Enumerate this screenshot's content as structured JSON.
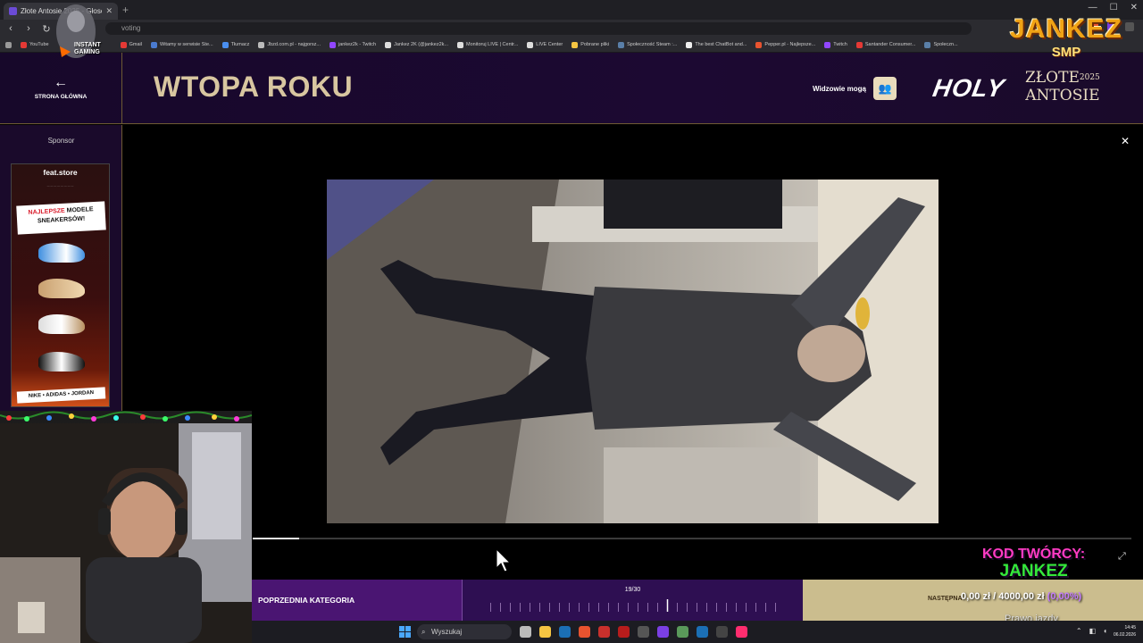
{
  "browser": {
    "tab_title": "Złote Antosie 2025 - Głosowanie",
    "url": "voting",
    "bookmarks": [
      "YouTube",
      "Gmail",
      "Witamy w serwisie Ste...",
      "Tłumacz",
      "Jbzd.com.pl - najgorsz...",
      "jankez2k - Twitch",
      "Jankez 2K (@jankez2k...",
      "Monitoruj LIVE | Centr...",
      "LIVE Center",
      "Pobrane pliki",
      "Społeczność Steam :...",
      "The best ChatBot and...",
      "Pepper.pl - Najlepsze...",
      "Twitch",
      "Santander Consumer...",
      "Społeczn..."
    ]
  },
  "header": {
    "back_label": "STRONA GŁÓWNA",
    "title": "WTOPA ROKU",
    "viewers_label": "Widzowie mogą",
    "logo_holy": "HOLY",
    "logo_zlote_line1": "ZŁOTE",
    "logo_year": "2025",
    "logo_zlote_line2": "ANTOSIE"
  },
  "sidebar": {
    "sponsor_label": "Sponsor",
    "ad": {
      "brand": "feat.store",
      "banner_line1_accent": "NAJLEPSZE",
      "banner_line1_rest": "MODELE",
      "banner_line2": "SNEAKERSÓW!",
      "footer": "NIKE • ADIDAS • JORDAN"
    }
  },
  "video": {
    "progress_fraction": 0.053
  },
  "overlay": {
    "channel_name": "JANKEZ",
    "channel_sub": "SMP",
    "instant_gaming": "INSTANT GAMING",
    "creator_code_label": "KOD TWÓRCY:",
    "creator_code_value": "JANKEZ",
    "donation_current": "0,00 zł",
    "donation_separator": "/",
    "donation_goal": "4000,00 zł",
    "donation_pct": "(0,00%)",
    "caption": "Prawo jazdy"
  },
  "bottom_nav": {
    "prev_label": "POPRZEDNIA KATEGORIA",
    "counter": "19/30",
    "current_index": 19,
    "total": 30,
    "next_label": "NASTĘPNA"
  },
  "taskbar": {
    "search_placeholder": "Wyszukaj",
    "time": "14:45",
    "date": "06.02.2026"
  },
  "colors": {
    "header_bg": "#1c0932",
    "title_gold": "#d8c6a0",
    "prev_purple": "#4a1572",
    "counter_purple": "#2e0f52",
    "next_beige": "#cbbd8e",
    "code_pink": "#ff3bc4",
    "code_green": "#34e83a"
  }
}
